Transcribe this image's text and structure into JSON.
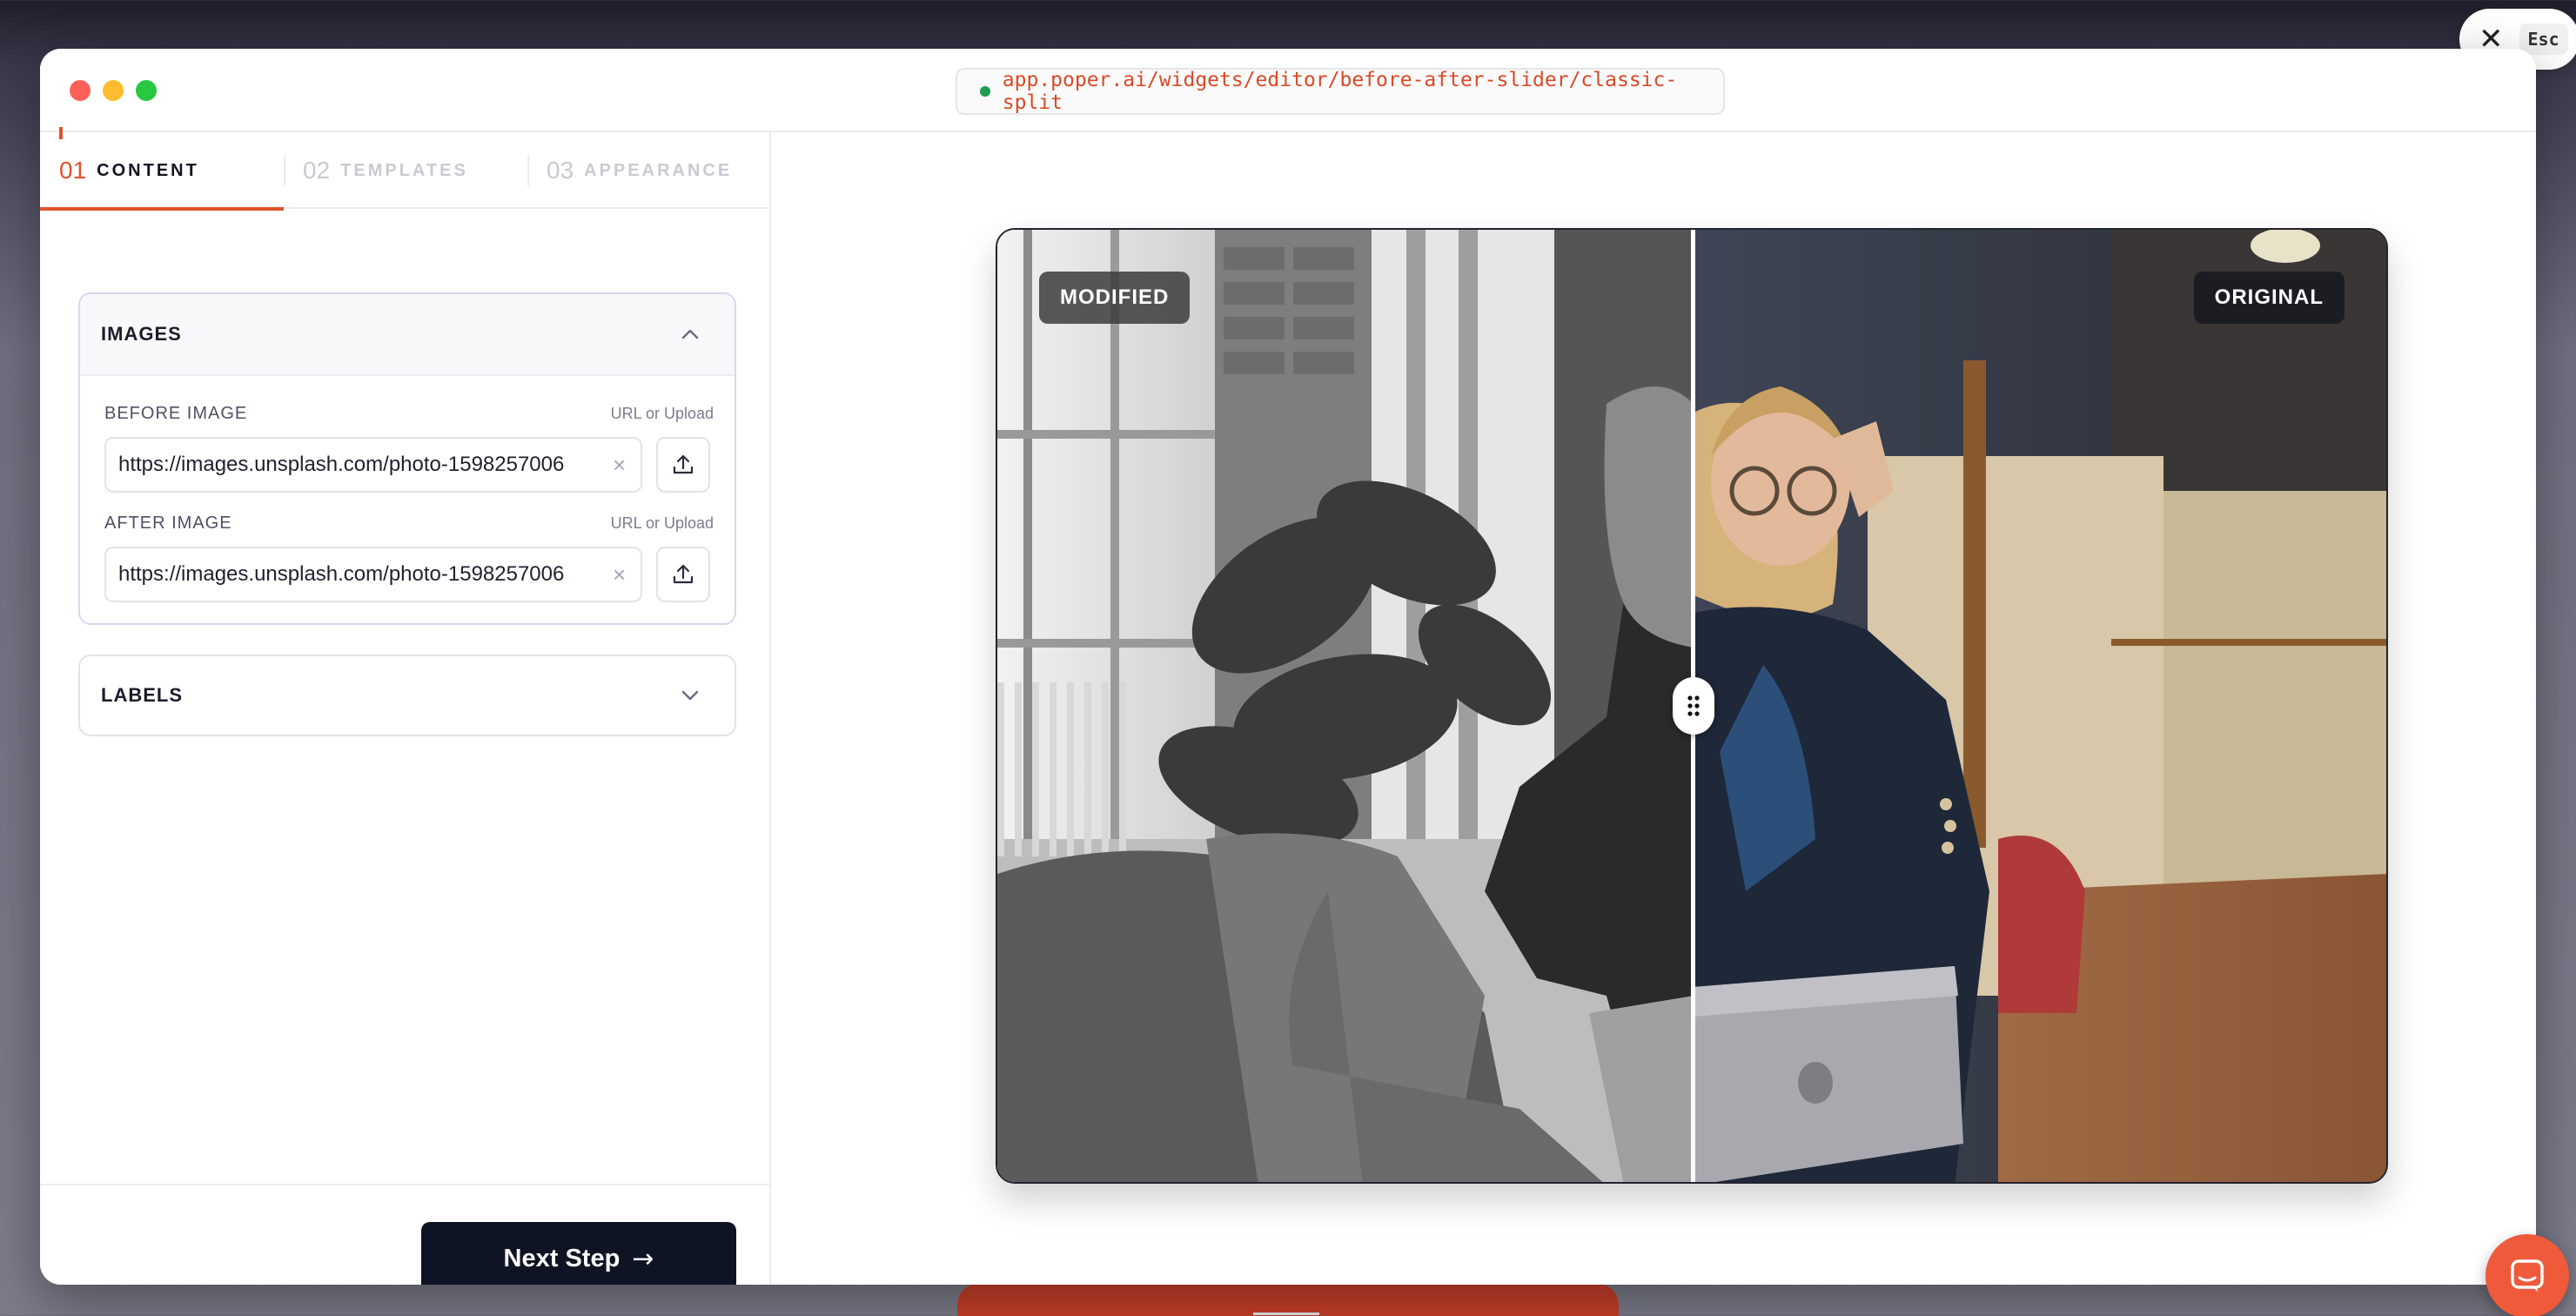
{
  "window": {
    "url": "app.poper.ai/widgets/editor/before-after-slider/classic-split"
  },
  "esc_chip": {
    "key_label": "Esc",
    "icon": "close-icon"
  },
  "tabs": [
    {
      "num": "01",
      "label": "CONTENT",
      "active": true
    },
    {
      "num": "02",
      "label": "TEMPLATES",
      "active": false
    },
    {
      "num": "03",
      "label": "APPEARANCE",
      "active": false
    }
  ],
  "images_section": {
    "title": "IMAGES",
    "expanded": true,
    "before": {
      "label": "BEFORE IMAGE",
      "hint": "URL or Upload",
      "value": "https://images.unsplash.com/photo-1598257006"
    },
    "after": {
      "label": "AFTER IMAGE",
      "hint": "URL or Upload",
      "value": "https://images.unsplash.com/photo-1598257006"
    }
  },
  "labels_section": {
    "title": "LABELS",
    "expanded": false
  },
  "footer": {
    "next_label": "Next Step"
  },
  "preview": {
    "left_label": "MODIFIED",
    "right_label": "ORIGINAL",
    "split_position": 0.5
  },
  "colors": {
    "accent": "#e0522b",
    "primary_button": "#0f1424",
    "chat_button": "#ee5a3a"
  }
}
